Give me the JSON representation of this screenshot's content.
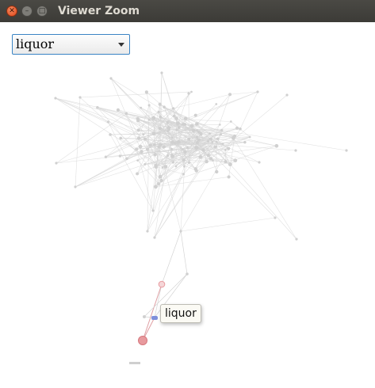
{
  "window": {
    "title": "Viewer Zoom",
    "close_icon": "close-icon",
    "minimize_icon": "minimize-icon",
    "maximize_icon": "maximize-icon"
  },
  "selector": {
    "value": "liquor",
    "caret_icon": "caret-down-icon"
  },
  "tooltip": {
    "text": "liquor"
  },
  "colors": {
    "titlebar": "#3c3b37",
    "close_button": "#e9541f",
    "select_border": "#3a84c4",
    "faded_node": "#d0d0d0",
    "faded_edge": "#d4d4d4",
    "highlight_node": "#e89a9e",
    "highlight_edge": "#e0a0a4",
    "selected_node": "#7f8fdb"
  }
}
